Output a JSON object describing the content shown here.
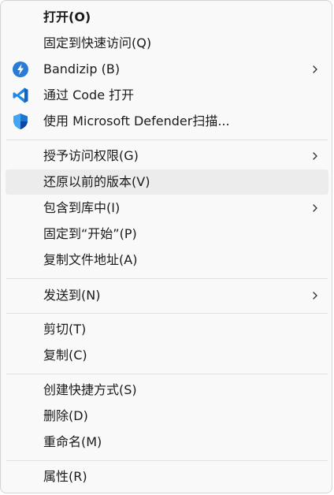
{
  "menu": {
    "items": [
      {
        "label": "打开(O)"
      },
      {
        "label": "固定到快速访问(Q)"
      },
      {
        "label": "Bandizip (B)",
        "icon": "bandizip-icon"
      },
      {
        "label": "通过 Code 打开",
        "icon": "vscode-icon"
      },
      {
        "label": "使用 Microsoft Defender扫描...",
        "icon": "defender-shield-icon"
      },
      {
        "label": "授予访问权限(G)"
      },
      {
        "label": "还原以前的版本(V)"
      },
      {
        "label": "包含到库中(I)"
      },
      {
        "label": "固定到“开始”(P)"
      },
      {
        "label": "复制文件地址(A)"
      },
      {
        "label": "发送到(N)"
      },
      {
        "label": "剪切(T)"
      },
      {
        "label": "复制(C)"
      },
      {
        "label": "创建快捷方式(S)"
      },
      {
        "label": "删除(D)"
      },
      {
        "label": "重命名(M)"
      },
      {
        "label": "属性(R)"
      }
    ]
  },
  "colors": {
    "menu_bg": "#f9f9f9",
    "hover_bg": "#ececec",
    "separator": "#e1e1e1",
    "bandizip_blue": "#2a7bd6",
    "vscode_blue": "#1e88e5",
    "defender_blue": "#1565c0"
  }
}
